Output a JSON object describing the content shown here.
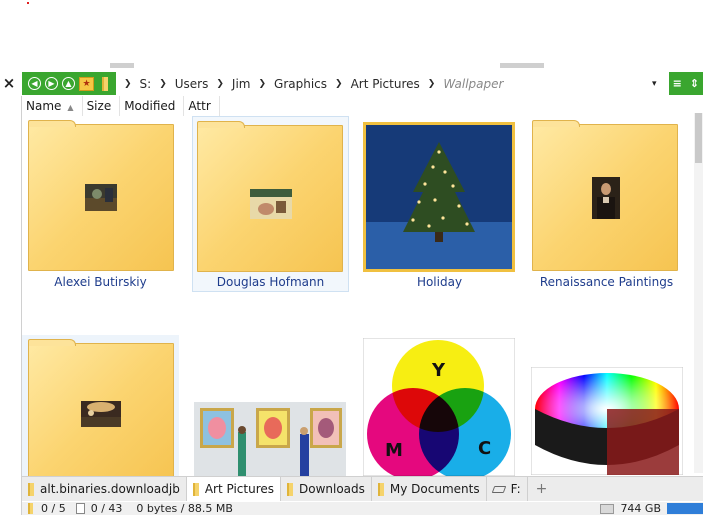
{
  "window": {
    "close_glyph": "×"
  },
  "breadcrumb": {
    "nav_icons": [
      "back-icon",
      "forward-icon",
      "up-icon"
    ],
    "favorites_icon": "star-folder-icon",
    "path": [
      "S:",
      "Users",
      "Jim",
      "Graphics",
      "Art Pictures"
    ],
    "current": "Wallpaper",
    "dropdown_glyph": "▾",
    "right_icons": [
      "filter-icon",
      "sort-icon"
    ]
  },
  "columns": [
    "Name",
    "Size",
    "Modified",
    "Attr"
  ],
  "items": [
    {
      "label": "Alexei Butirskiy",
      "kind": "folder"
    },
    {
      "label": "Douglas Hofmann",
      "kind": "folder"
    },
    {
      "label": "Holiday",
      "kind": "image"
    },
    {
      "label": "Renaissance Paintings",
      "kind": "folder"
    },
    {
      "label": "",
      "kind": "folder"
    },
    {
      "label": "",
      "kind": "image"
    },
    {
      "label": "",
      "kind": "image"
    },
    {
      "label": "",
      "kind": "image"
    }
  ],
  "color_wheel": {
    "y": "Y",
    "m": "M",
    "c": "C"
  },
  "tabs": [
    {
      "label": "alt.binaries.downloadjb",
      "active": false
    },
    {
      "label": "Art Pictures",
      "active": true
    },
    {
      "label": "Downloads",
      "active": false
    },
    {
      "label": "My Documents",
      "active": false
    },
    {
      "label": "F:",
      "active": false
    }
  ],
  "tab_add": "+",
  "status": {
    "folders": "0 / 5",
    "files": "0 / 43",
    "size": "0 bytes / 88.5 MB",
    "drive": "744 GB"
  },
  "colors": {
    "accent": "#3aa62f",
    "link": "#1e3c8c",
    "folder": "#fbd470"
  }
}
